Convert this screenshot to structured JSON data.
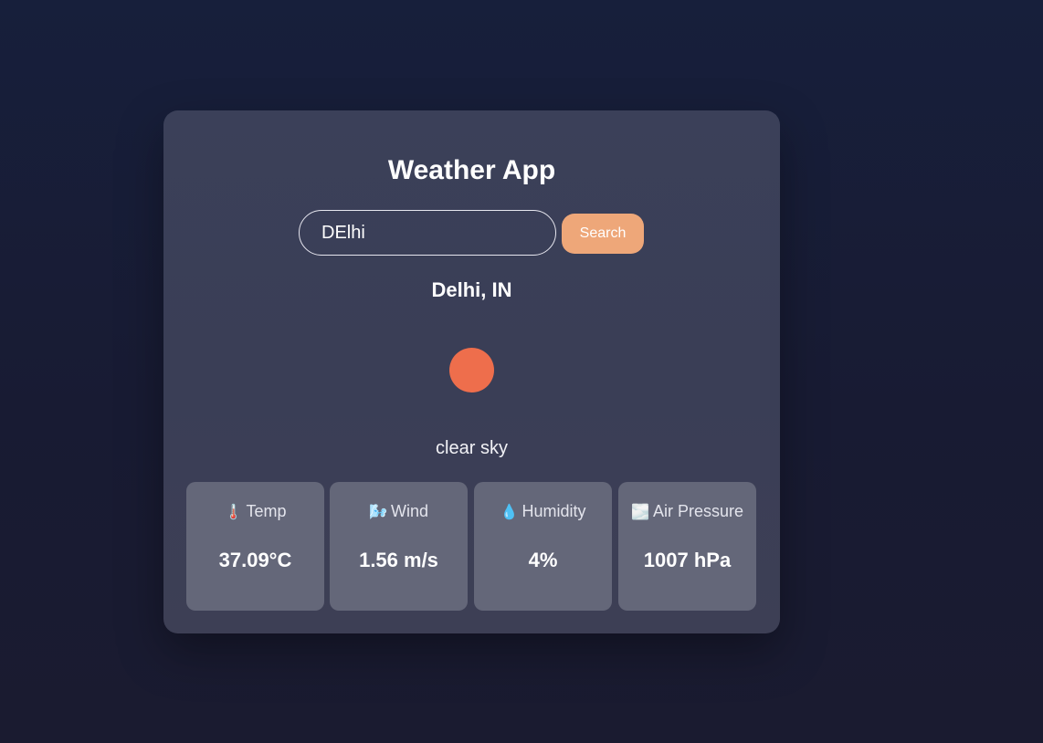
{
  "app": {
    "title": "Weather App"
  },
  "search": {
    "value": "DElhi",
    "button_label": "Search"
  },
  "weather": {
    "location": "Delhi, IN",
    "description": "clear sky",
    "icon_name": "sun-icon",
    "icon_color": "#ee6e4c"
  },
  "stats": [
    {
      "icon": "🌡️",
      "icon_name": "thermometer-icon",
      "label": "Temp",
      "value": "37.09°C"
    },
    {
      "icon": "🌬️",
      "icon_name": "wind-face-icon",
      "label": "Wind",
      "value": "1.56 m/s"
    },
    {
      "icon": "💧",
      "icon_name": "droplet-icon",
      "label": "Humidity",
      "value": "4%"
    },
    {
      "icon": "🌫️",
      "icon_name": "pressure-icon",
      "label": "Air Pressure",
      "value": "1007 hPa"
    }
  ],
  "colors": {
    "background": "#171f3b",
    "card": "#3b4059",
    "stat_card": "#646779",
    "accent": "#eea779"
  }
}
